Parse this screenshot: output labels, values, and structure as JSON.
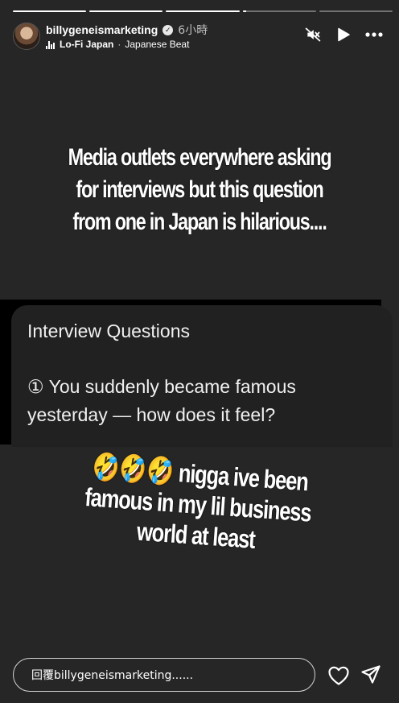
{
  "story": {
    "segments": [
      1,
      1,
      1,
      0.05,
      0
    ],
    "username": "billygeneismarketing",
    "verified": true,
    "time": "6小時",
    "music_title": "Lo-Fi Japan",
    "music_separator": "·",
    "music_artist": "Japanese Beat"
  },
  "controls": {
    "mute_icon": "muted-speaker-icon",
    "play_icon": "play-icon",
    "more_icon": "more-icon"
  },
  "content": {
    "headline": "Media outlets everywhere asking for interviews but this question from one in Japan is hilarious....",
    "screenshot_title": "Interview Questions",
    "screenshot_question": "① You suddenly became famous yesterday — how does it feel?",
    "caption_emoji": "🤣🤣🤣",
    "caption_text": "nigga ive been famous in my lil business world at least"
  },
  "reply": {
    "placeholder": "回覆billygeneismarketing......"
  },
  "actions": {
    "like_icon": "heart-icon",
    "share_icon": "send-icon"
  }
}
